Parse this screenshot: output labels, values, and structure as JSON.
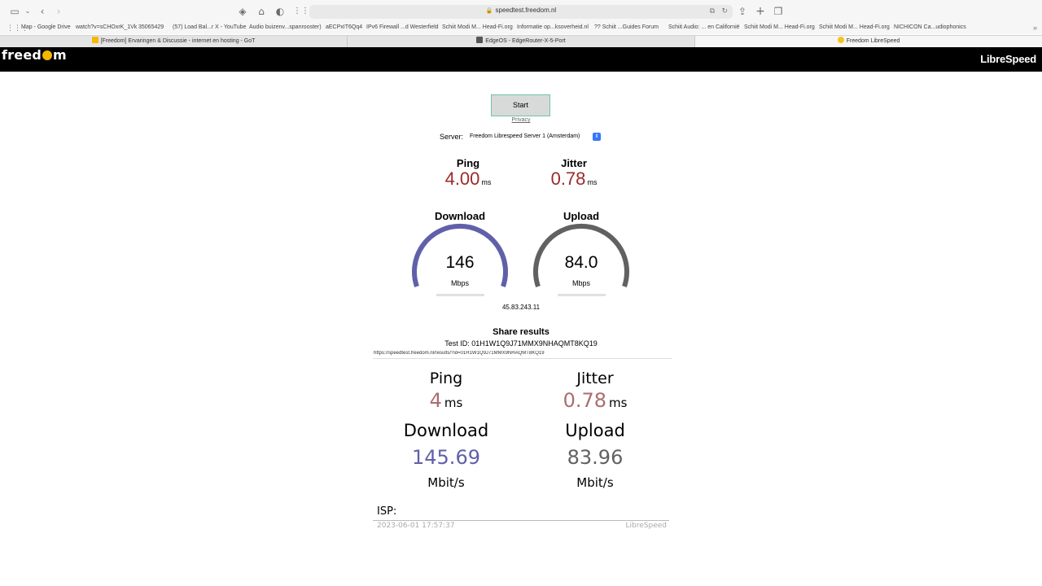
{
  "browser": {
    "url": "speedtest.freedom.nl",
    "bookmarks": [
      "Map - Google Drive",
      "watch?v=sCHOxrK_1Vk",
      "35065429",
      "(57) Load Bal...r X - YouTube",
      "Audio buizenv...spanrooster)",
      "aECPxIT6Qq4",
      "IPv6 Firewall ...d Westerfield",
      "Schiit Modi M... Head-Fi.org",
      "Informatie op...ksoverheid.nl",
      "?? Schiit ...Guides Forum",
      "Schiit Audio: ... en Californië",
      "Schiit Modi M... Head-Fi.org",
      "Schiit Modi M... Head-Fi.org",
      "NICHICON Ca...udiophonics"
    ],
    "tabs": [
      {
        "title": "[Freedom] Ervaringen & Discussie - internet en hosting - GoT",
        "favicon_color": "#f5b800"
      },
      {
        "title": "EdgeOS - EdgeRouter-X-5-Port",
        "favicon_color": "#555555"
      },
      {
        "title": "Freedom LibreSpeed",
        "favicon_color": "#f5c518"
      }
    ]
  },
  "header": {
    "brand_left": "freedom",
    "brand_right": "LibreSpeed"
  },
  "speedtest": {
    "start_label": "Start",
    "privacy_label": "Privacy",
    "server_label": "Server:",
    "server_value": "Freedom Librespeed Server 1 (Amsterdam)",
    "ping": {
      "title": "Ping",
      "value": "4.00",
      "unit": "ms"
    },
    "jitter": {
      "title": "Jitter",
      "value": "0.78",
      "unit": "ms"
    },
    "download": {
      "title": "Download",
      "value": "146",
      "unit": "Mbps",
      "color": "#6060aa"
    },
    "upload": {
      "title": "Upload",
      "value": "84.0",
      "unit": "Mbps",
      "color": "#616161"
    },
    "ip": "45.83.243.11"
  },
  "share": {
    "title": "Share results",
    "test_id": "Test ID: 01H1W1Q9J71MMX9NHAQMT8KQ19",
    "url": "https://speedtest.freedom.nl/results/?id=01H1W1Q9J71MMX9NHAQMT8KQ19"
  },
  "result_image": {
    "ping": {
      "title": "Ping",
      "value": "4",
      "unit": "ms",
      "color": "#aa6e6e"
    },
    "jitter": {
      "title": "Jitter",
      "value": "0.78",
      "unit": "ms",
      "color": "#aa6e6e"
    },
    "download": {
      "title": "Download",
      "value": "145.69",
      "unit": "Mbit/s",
      "color": "#6060aa"
    },
    "upload": {
      "title": "Upload",
      "value": "83.96",
      "unit": "Mbit/s",
      "color": "#616161"
    },
    "isp_label": "ISP:",
    "timestamp": "2023-06-01 17:57:37",
    "footer_brand": "LibreSpeed"
  }
}
